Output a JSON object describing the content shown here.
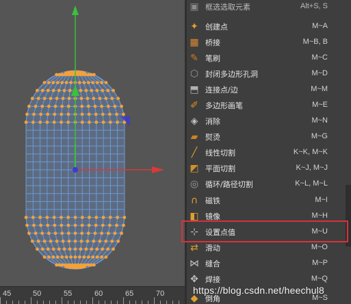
{
  "menu": {
    "items": [
      {
        "label": "框选选取元素",
        "shortcut": "Alt+S, S",
        "icon": "box-select-icon",
        "color": "#8a8a8a"
      },
      {
        "label": "创建点",
        "shortcut": "M~A",
        "icon": "create-point-icon",
        "color": "#e0a030"
      },
      {
        "label": "桥接",
        "shortcut": "M~B, B",
        "icon": "bridge-icon",
        "color": "#e08a30"
      },
      {
        "label": "笔刷",
        "shortcut": "M~C",
        "icon": "brush-icon",
        "color": "#d07a20"
      },
      {
        "label": "封闭多边形孔洞",
        "shortcut": "M~D",
        "icon": "close-hole-icon",
        "color": "#9a9a9a"
      },
      {
        "label": "连接点/边",
        "shortcut": "M~M",
        "icon": "connect-points-icon",
        "color": "#b0b0b0"
      },
      {
        "label": "多边形画笔",
        "shortcut": "M~E",
        "icon": "polygon-pen-icon",
        "color": "#e09020"
      },
      {
        "label": "消除",
        "shortcut": "M~N",
        "icon": "dissolve-icon",
        "color": "#c0c0c0"
      },
      {
        "label": "熨烫",
        "shortcut": "M~G",
        "icon": "iron-icon",
        "color": "#d08020"
      },
      {
        "label": "线性切割",
        "shortcut": "K~K, M~K",
        "icon": "line-cut-icon",
        "color": "#e0a030"
      },
      {
        "label": "平面切割",
        "shortcut": "K~J, M~J",
        "icon": "plane-cut-icon",
        "color": "#d09030"
      },
      {
        "label": "循环/路径切割",
        "shortcut": "K~L, M~L",
        "icon": "loop-cut-icon",
        "color": "#a0a0a0"
      },
      {
        "label": "磁铁",
        "shortcut": "M~I",
        "icon": "magnet-icon",
        "color": "#e0a030"
      },
      {
        "label": "镜像",
        "shortcut": "M~H",
        "icon": "mirror-icon",
        "color": "#e0a030"
      },
      {
        "label": "设置点值",
        "shortcut": "M~U",
        "icon": "set-point-value-icon",
        "color": "#c0c0c0"
      },
      {
        "label": "滑动",
        "shortcut": "M~O",
        "icon": "slide-icon",
        "color": "#e0a030"
      },
      {
        "label": "缝合",
        "shortcut": "M~P",
        "icon": "stitch-icon",
        "color": "#c0c0c0"
      },
      {
        "label": "焊接",
        "shortcut": "M~Q",
        "icon": "weld-icon",
        "color": "#c0c0c0"
      },
      {
        "label": "倒角",
        "shortcut": "M~S",
        "icon": "bevel-icon",
        "color": "#e0a030"
      }
    ],
    "highlighted_label": "设置点值"
  },
  "ruler": {
    "labels": [
      "45",
      "50",
      "55",
      "60",
      "65",
      "70"
    ]
  },
  "watermark": "https://blog.csdn.net/heechul8",
  "colors": {
    "viewport_bg": "#555555",
    "menu_bg": "#3e3e3e",
    "highlight": "#d9323a",
    "mesh_line": "#6a9ad8",
    "vertex": "#f4a13a",
    "axis_x": "#d83a3a",
    "axis_y": "#3ac23a",
    "axis_z": "#3a3ad8"
  }
}
